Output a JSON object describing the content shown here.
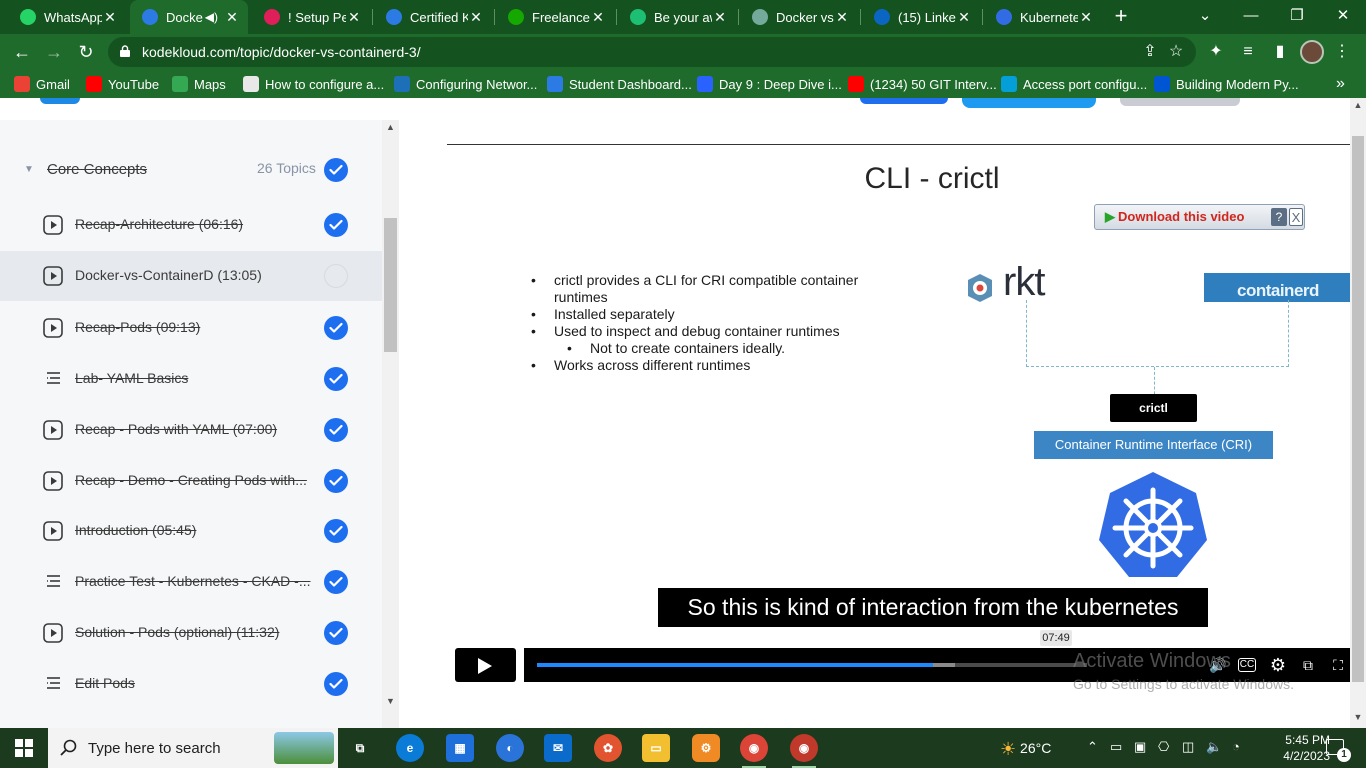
{
  "browser": {
    "tabs": [
      {
        "title": "WhatsApp",
        "icon": "whatsapp-icon",
        "color": "#25d366"
      },
      {
        "title": "Docke",
        "icon": "kodekloud-icon",
        "color": "#2c7be5",
        "active": true
      },
      {
        "title": "! Setup Pe",
        "icon": "slack-icon",
        "color": "#e01e5a"
      },
      {
        "title": "Certified K",
        "icon": "kodekloud-icon",
        "color": "#2c7be5"
      },
      {
        "title": "Freelance",
        "icon": "upwork-icon",
        "color": "#14a800"
      },
      {
        "title": "Be your aw",
        "icon": "fiverr-icon",
        "color": "#1dbf73"
      },
      {
        "title": "Docker vs",
        "icon": "chatgpt-icon",
        "color": "#74aa9c"
      },
      {
        "title": "(15) Linked",
        "icon": "linkedin-icon",
        "color": "#0a66c2"
      },
      {
        "title": "Kubernete",
        "icon": "kubernetes-icon",
        "color": "#326ce5"
      }
    ],
    "url": "kodekloud.com/topic/docker-vs-containerd-3/",
    "bookmarks": [
      {
        "label": "Gmail",
        "icon": "gmail-icon",
        "color": "#ea4335"
      },
      {
        "label": "YouTube",
        "icon": "youtube-icon",
        "color": "#ff0000"
      },
      {
        "label": "Maps",
        "icon": "maps-icon",
        "color": "#34a853"
      },
      {
        "label": "How to configure a...",
        "icon": "page-icon",
        "color": "#e8e8e8"
      },
      {
        "label": "Configuring Networ...",
        "icon": "vmware-icon",
        "color": "#1d6fb8"
      },
      {
        "label": "Student Dashboard...",
        "icon": "kodekloud-icon",
        "color": "#2c7be5"
      },
      {
        "label": "Day 9 : Deep Dive i...",
        "icon": "diamond-icon",
        "color": "#2962ff"
      },
      {
        "label": "(1234) 50 GIT Interv...",
        "icon": "youtube-icon",
        "color": "#ff0000"
      },
      {
        "label": "Access port configu...",
        "icon": "cisco-icon",
        "color": "#049fd9"
      },
      {
        "label": "Building Modern Py...",
        "icon": "coursera-icon",
        "color": "#0056d2"
      }
    ]
  },
  "sidebar": {
    "section": {
      "title": "Core Concepts",
      "count": "26 Topics"
    },
    "lessons": [
      {
        "label": "Recap-Architecture (06:16)",
        "type": "video",
        "done": true
      },
      {
        "label": "Docker-vs-ContainerD (13:05)",
        "type": "video",
        "done": false,
        "current": true
      },
      {
        "label": "Recap-Pods (09:13)",
        "type": "video",
        "done": true
      },
      {
        "label": "Lab- YAML Basics",
        "type": "lab",
        "done": true
      },
      {
        "label": "Recap - Pods with YAML (07:00)",
        "type": "video",
        "done": true
      },
      {
        "label": "Recap - Demo - Creating Pods with...",
        "type": "video",
        "done": true
      },
      {
        "label": "Introduction (05:45)",
        "type": "video",
        "done": true
      },
      {
        "label": "Practice Test - Kubernetes - CKAD -...",
        "type": "lab",
        "done": true
      },
      {
        "label": "Solution - Pods (optional) (11:32)",
        "type": "video",
        "done": true
      },
      {
        "label": "Edit Pods",
        "type": "lab",
        "done": true
      }
    ]
  },
  "video": {
    "slide_title": "CLI - crictl",
    "download_label": "Download this video",
    "download_help": "?",
    "download_close": "X",
    "bullets": [
      {
        "text": "crictl provides a CLI for CRI compatible container runtimes",
        "level": 1
      },
      {
        "text": "Installed separately",
        "level": 1
      },
      {
        "text": "Used to inspect and debug container runtimes",
        "level": 1
      },
      {
        "text": "Not to create containers ideally.",
        "level": 2
      },
      {
        "text": "Works across different runtimes",
        "level": 1
      }
    ],
    "diagram": {
      "rkt": "rkt",
      "containerd": "containerd",
      "crictl": "crictl",
      "cri": "Container Runtime Interface (CRI)"
    },
    "caption": "So this is kind of interaction from the kubernetes",
    "hover_time": "07:49",
    "progress": 0.72,
    "buffered": 0.76,
    "watermark_title": "Activate Windows",
    "watermark_sub": "Go to Settings to activate Windows."
  },
  "taskbar": {
    "search_placeholder": "Type here to search",
    "weather": "26°C",
    "time": "5:45 PM",
    "date": "4/2/2023",
    "notifications": "1"
  }
}
